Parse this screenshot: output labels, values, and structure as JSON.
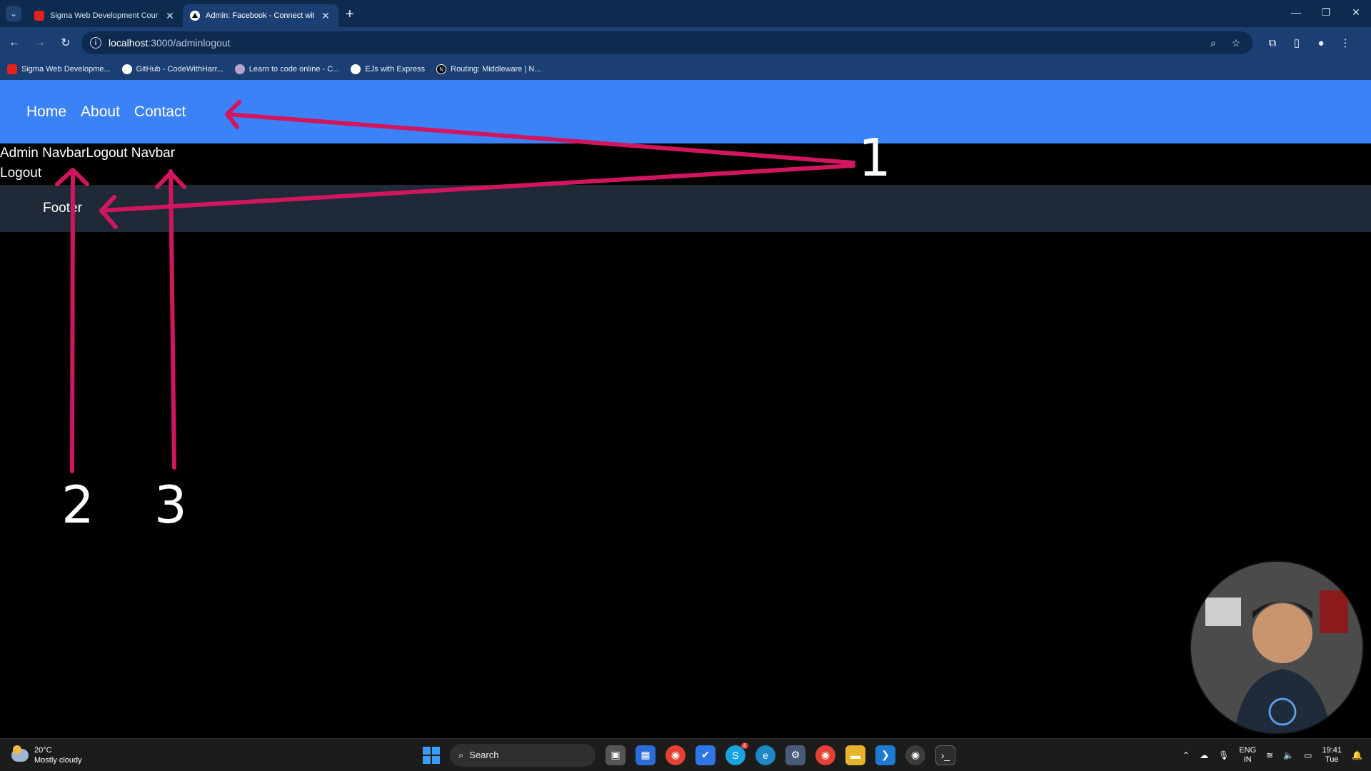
{
  "browser": {
    "tabs": [
      {
        "title": "Sigma Web Development Course - W",
        "favicon": "youtube-icon",
        "active": false
      },
      {
        "title": "Admin: Facebook - Connect with frie",
        "favicon": "triangle-icon",
        "active": true
      }
    ],
    "url_host": "localhost",
    "url_path": ":3000/adminlogout",
    "bookmarks": [
      {
        "label": "Sigma Web Developme...",
        "icon": "youtube-icon"
      },
      {
        "label": "GitHub - CodeWithHarr...",
        "icon": "github-icon"
      },
      {
        "label": "Learn to code online - C...",
        "icon": "freecodecamp-icon"
      },
      {
        "label": "EJs with Express",
        "icon": "github-icon"
      },
      {
        "label": "Routing: Middleware | N...",
        "icon": "n-icon"
      }
    ]
  },
  "page": {
    "nav_links": [
      "Home",
      "About",
      "Contact"
    ],
    "partial_line1": "Admin NavbarLogout Navbar",
    "partial_line2": "Logout",
    "footer": "Footer"
  },
  "annotations": {
    "labels": [
      "1",
      "2",
      "3"
    ],
    "color": "#d1165f"
  },
  "taskbar": {
    "weather_temp": "20°C",
    "weather_desc": "Mostly cloudy",
    "search_label": "Search",
    "lang_line1": "ENG",
    "lang_line2": "IN",
    "time": "19:41",
    "day": "Tue",
    "skype_badge": "4"
  }
}
